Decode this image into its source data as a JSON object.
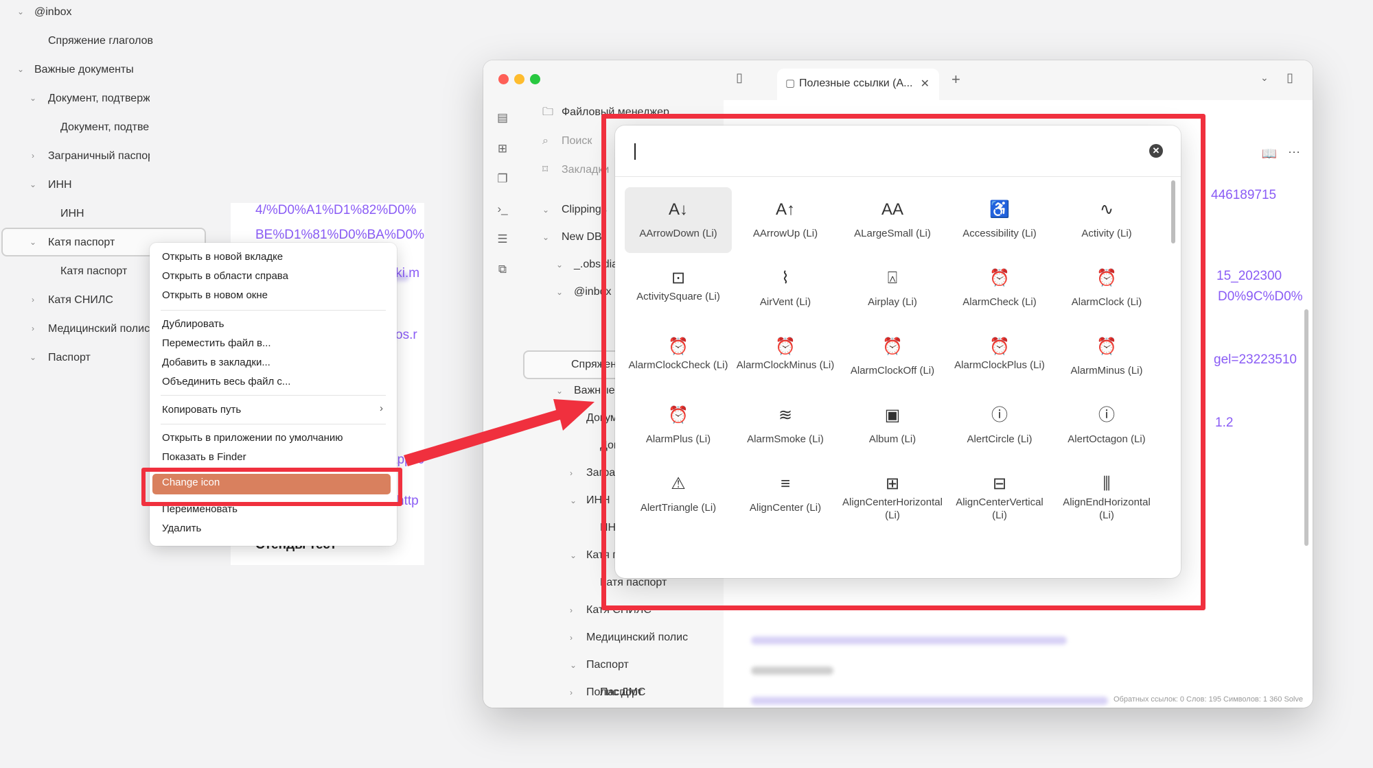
{
  "left_tree": {
    "items": [
      {
        "label": "@inbox",
        "top": 0
      },
      {
        "label": "Спряжение глаголов"
      },
      {
        "label": "Важные документы"
      },
      {
        "label": "Документ, подтверждающий"
      },
      {
        "label": "Документ, подтверждающий"
      },
      {
        "label": "Заграничный паспорт"
      },
      {
        "label": "ИНН"
      },
      {
        "label": "ИНН"
      },
      {
        "label": "Катя паспорт"
      },
      {
        "label": "Катя паспорт"
      },
      {
        "label": "Катя СНИЛС"
      },
      {
        "label": "Медицинский полис"
      },
      {
        "label": "Паспорт"
      }
    ]
  },
  "left_doc": {
    "link1": "4/%D0%A1%D1%82%D0%",
    "link2": "BE%D1%81%D0%BA%D0%",
    "link3": "iki.m",
    "link4": "os.r",
    "link5": "applic",
    "link6": "http",
    "heading": "Стенды тест"
  },
  "context_menu": {
    "open_new_tab": "Открыть в новой вкладке",
    "open_right": "Открыть в области справа",
    "open_new_window": "Открыть в новом окне",
    "duplicate": "Дублировать",
    "move_file": "Переместить файл в...",
    "add_bookmark": "Добавить в закладки...",
    "merge_file": "Объединить весь файл с...",
    "copy_path": "Копировать путь",
    "open_default_app": "Открыть в приложении по умолчанию",
    "show_in_finder": "Показать в Finder",
    "change_icon": "Change icon",
    "rename": "Переименовать",
    "delete": "Удалить"
  },
  "window": {
    "tab_title": "Полезные ссылки (А...",
    "sidebar": {
      "file_manager": "Файловый менеджер",
      "search": "Поиск",
      "bookmarks": "Закладки",
      "clippings": "Clippings",
      "new_db": "New DB",
      "obsidian": "_.obsidian",
      "inbox": "@inbox",
      "selected": "Спряжение",
      "important": "Важные документы",
      "doc": "Документ",
      "doc2": "Документ",
      "passport_foreign": "Заграничный паспорт",
      "inn": "ИНН",
      "inn2": "ИНН",
      "katya": "Катя паспорт",
      "katya2": "Катя паспорт",
      "katya_snils": "Катя СНИЛС",
      "medical": "Медицинский полис",
      "passport": "Паспорт",
      "passport2": "Паспорт",
      "dms": "Полис ДМС"
    },
    "editor": {
      "link_a": "446189715",
      "link_b": "15_202300",
      "link_c": "D0%9C%D0%",
      "link_d": "gel=23223510",
      "link_e": "1.2",
      "status": "Обратных ссылок: 0    Слов: 195  Символов: 1 360   Solve"
    }
  },
  "picker": {
    "input_value": "",
    "icons": [
      {
        "glyph": "A↓",
        "label": "AArrowDown (Li)"
      },
      {
        "glyph": "A↑",
        "label": "AArrowUp (Li)"
      },
      {
        "glyph": "AA",
        "label": "ALargeSmall (Li)"
      },
      {
        "glyph": "♿",
        "label": "Accessibility (Li)"
      },
      {
        "glyph": "∿",
        "label": "Activity (Li)"
      },
      {
        "glyph": "⊡",
        "label": "ActivitySquare (Li)"
      },
      {
        "glyph": "⌇",
        "label": "AirVent (Li)"
      },
      {
        "glyph": "⍓",
        "label": "Airplay (Li)"
      },
      {
        "glyph": "⏰",
        "label": "AlarmCheck (Li)"
      },
      {
        "glyph": "⏰",
        "label": "AlarmClock (Li)"
      },
      {
        "glyph": "⏰",
        "label": "AlarmClockCheck (Li)"
      },
      {
        "glyph": "⏰",
        "label": "AlarmClockMinus (Li)"
      },
      {
        "glyph": "⏰",
        "label": "AlarmClockOff (Li)"
      },
      {
        "glyph": "⏰",
        "label": "AlarmClockPlus (Li)"
      },
      {
        "glyph": "⏰",
        "label": "AlarmMinus (Li)"
      },
      {
        "glyph": "⏰",
        "label": "AlarmPlus (Li)"
      },
      {
        "glyph": "≋",
        "label": "AlarmSmoke (Li)"
      },
      {
        "glyph": "▣",
        "label": "Album (Li)"
      },
      {
        "glyph": "ⓘ",
        "label": "AlertCircle (Li)"
      },
      {
        "glyph": "ⓘ",
        "label": "AlertOctagon (Li)"
      },
      {
        "glyph": "⚠",
        "label": "AlertTriangle (Li)"
      },
      {
        "glyph": "≡",
        "label": "AlignCenter (Li)"
      },
      {
        "glyph": "⊞",
        "label": "AlignCenterHorizontal (Li)"
      },
      {
        "glyph": "⊟",
        "label": "AlignCenterVertical (Li)"
      },
      {
        "glyph": "⫼",
        "label": "AlignEndHorizontal (Li)"
      }
    ]
  },
  "colors": {
    "accent_link": "#8a5cf5",
    "highlight_red": "#f0303e",
    "menu_highlight": "#d9805e"
  }
}
